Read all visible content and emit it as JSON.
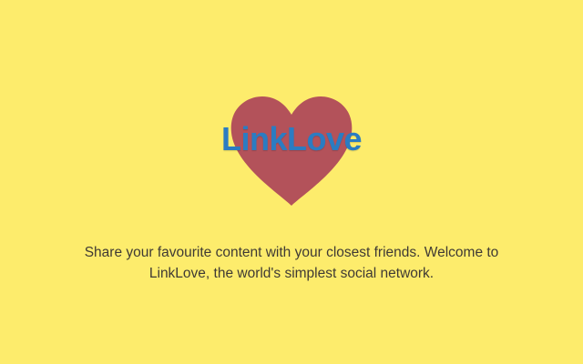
{
  "app": {
    "name": "LinkLove",
    "tagline": "Share your favourite content with your closest friends. Welcome to LinkLove, the world's simplest social network."
  },
  "logo": {
    "icon": "heart-icon",
    "heart_color": "#b3525a",
    "text_color": "#2b7cc2"
  },
  "colors": {
    "background": "#fdec6c"
  }
}
